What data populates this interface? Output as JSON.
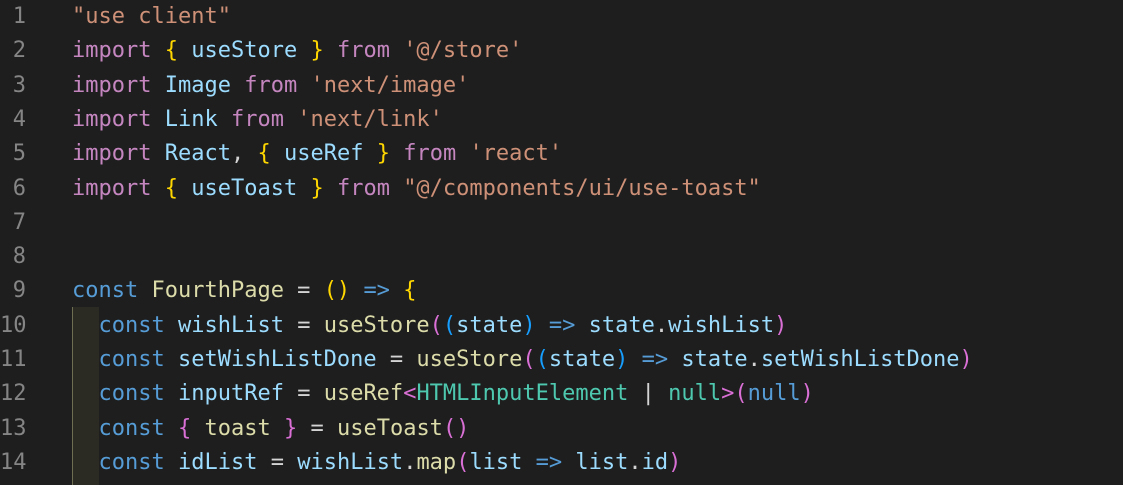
{
  "editor": {
    "lines": [
      {
        "n": "1",
        "tokens": [
          {
            "t": "\"use client\"",
            "c": "str"
          }
        ]
      },
      {
        "n": "2",
        "tokens": [
          {
            "t": "import",
            "c": "kw"
          },
          {
            "t": " ",
            "c": "plain"
          },
          {
            "t": "{",
            "c": "b1"
          },
          {
            "t": " ",
            "c": "plain"
          },
          {
            "t": "useStore",
            "c": "var"
          },
          {
            "t": " ",
            "c": "plain"
          },
          {
            "t": "}",
            "c": "b1"
          },
          {
            "t": " ",
            "c": "plain"
          },
          {
            "t": "from",
            "c": "kw"
          },
          {
            "t": " ",
            "c": "plain"
          },
          {
            "t": "'@/store'",
            "c": "str"
          }
        ]
      },
      {
        "n": "3",
        "tokens": [
          {
            "t": "import",
            "c": "kw"
          },
          {
            "t": " ",
            "c": "plain"
          },
          {
            "t": "Image",
            "c": "var"
          },
          {
            "t": " ",
            "c": "plain"
          },
          {
            "t": "from",
            "c": "kw"
          },
          {
            "t": " ",
            "c": "plain"
          },
          {
            "t": "'next/image'",
            "c": "str"
          }
        ]
      },
      {
        "n": "4",
        "tokens": [
          {
            "t": "import",
            "c": "kw"
          },
          {
            "t": " ",
            "c": "plain"
          },
          {
            "t": "Link",
            "c": "var"
          },
          {
            "t": " ",
            "c": "plain"
          },
          {
            "t": "from",
            "c": "kw"
          },
          {
            "t": " ",
            "c": "plain"
          },
          {
            "t": "'next/link'",
            "c": "str"
          }
        ]
      },
      {
        "n": "5",
        "tokens": [
          {
            "t": "import",
            "c": "kw"
          },
          {
            "t": " ",
            "c": "plain"
          },
          {
            "t": "React",
            "c": "var"
          },
          {
            "t": ", ",
            "c": "plain"
          },
          {
            "t": "{",
            "c": "b1"
          },
          {
            "t": " ",
            "c": "plain"
          },
          {
            "t": "useRef",
            "c": "var"
          },
          {
            "t": " ",
            "c": "plain"
          },
          {
            "t": "}",
            "c": "b1"
          },
          {
            "t": " ",
            "c": "plain"
          },
          {
            "t": "from",
            "c": "kw"
          },
          {
            "t": " ",
            "c": "plain"
          },
          {
            "t": "'react'",
            "c": "str"
          }
        ]
      },
      {
        "n": "6",
        "tokens": [
          {
            "t": "import",
            "c": "kw"
          },
          {
            "t": " ",
            "c": "plain"
          },
          {
            "t": "{",
            "c": "b1"
          },
          {
            "t": " ",
            "c": "plain"
          },
          {
            "t": "useToast",
            "c": "var"
          },
          {
            "t": " ",
            "c": "plain"
          },
          {
            "t": "}",
            "c": "b1"
          },
          {
            "t": " ",
            "c": "plain"
          },
          {
            "t": "from",
            "c": "kw"
          },
          {
            "t": " ",
            "c": "plain"
          },
          {
            "t": "\"@/components/ui/use-toast\"",
            "c": "str"
          }
        ]
      },
      {
        "n": "7",
        "tokens": []
      },
      {
        "n": "8",
        "tokens": []
      },
      {
        "n": "9",
        "tokens": [
          {
            "t": "const",
            "c": "kwb"
          },
          {
            "t": " ",
            "c": "plain"
          },
          {
            "t": "FourthPage",
            "c": "fn"
          },
          {
            "t": " = ",
            "c": "plain"
          },
          {
            "t": "()",
            "c": "b1"
          },
          {
            "t": " ",
            "c": "plain"
          },
          {
            "t": "=>",
            "c": "kwb"
          },
          {
            "t": " ",
            "c": "plain"
          },
          {
            "t": "{",
            "c": "b1"
          }
        ]
      },
      {
        "n": "10",
        "tokens": [
          {
            "t": "  ",
            "c": "plain"
          },
          {
            "t": "const",
            "c": "kwb"
          },
          {
            "t": " ",
            "c": "plain"
          },
          {
            "t": "wishList",
            "c": "var"
          },
          {
            "t": " = ",
            "c": "plain"
          },
          {
            "t": "useStore",
            "c": "fn"
          },
          {
            "t": "(",
            "c": "b2"
          },
          {
            "t": "(",
            "c": "b3"
          },
          {
            "t": "state",
            "c": "var"
          },
          {
            "t": ")",
            "c": "b3"
          },
          {
            "t": " ",
            "c": "plain"
          },
          {
            "t": "=>",
            "c": "kwb"
          },
          {
            "t": " ",
            "c": "plain"
          },
          {
            "t": "state",
            "c": "var"
          },
          {
            "t": ".",
            "c": "plain"
          },
          {
            "t": "wishList",
            "c": "var"
          },
          {
            "t": ")",
            "c": "b2"
          }
        ]
      },
      {
        "n": "11",
        "tokens": [
          {
            "t": "  ",
            "c": "plain"
          },
          {
            "t": "const",
            "c": "kwb"
          },
          {
            "t": " ",
            "c": "plain"
          },
          {
            "t": "setWishListDone",
            "c": "var"
          },
          {
            "t": " = ",
            "c": "plain"
          },
          {
            "t": "useStore",
            "c": "fn"
          },
          {
            "t": "(",
            "c": "b2"
          },
          {
            "t": "(",
            "c": "b3"
          },
          {
            "t": "state",
            "c": "var"
          },
          {
            "t": ")",
            "c": "b3"
          },
          {
            "t": " ",
            "c": "plain"
          },
          {
            "t": "=>",
            "c": "kwb"
          },
          {
            "t": " ",
            "c": "plain"
          },
          {
            "t": "state",
            "c": "var"
          },
          {
            "t": ".",
            "c": "plain"
          },
          {
            "t": "setWishListDone",
            "c": "var"
          },
          {
            "t": ")",
            "c": "b2"
          }
        ]
      },
      {
        "n": "12",
        "tokens": [
          {
            "t": "  ",
            "c": "plain"
          },
          {
            "t": "const",
            "c": "kwb"
          },
          {
            "t": " ",
            "c": "plain"
          },
          {
            "t": "inputRef",
            "c": "var"
          },
          {
            "t": " = ",
            "c": "plain"
          },
          {
            "t": "useRef",
            "c": "fn"
          },
          {
            "t": "<",
            "c": "b2"
          },
          {
            "t": "HTMLInputElement",
            "c": "ty"
          },
          {
            "t": " | ",
            "c": "plain"
          },
          {
            "t": "null",
            "c": "ty"
          },
          {
            "t": ">",
            "c": "b2"
          },
          {
            "t": "(",
            "c": "b2"
          },
          {
            "t": "null",
            "c": "kwb"
          },
          {
            "t": ")",
            "c": "b2"
          }
        ]
      },
      {
        "n": "13",
        "tokens": [
          {
            "t": "  ",
            "c": "plain"
          },
          {
            "t": "const",
            "c": "kwb"
          },
          {
            "t": " ",
            "c": "plain"
          },
          {
            "t": "{",
            "c": "b2"
          },
          {
            "t": " ",
            "c": "plain"
          },
          {
            "t": "toast",
            "c": "fn"
          },
          {
            "t": " ",
            "c": "plain"
          },
          {
            "t": "}",
            "c": "b2"
          },
          {
            "t": " = ",
            "c": "plain"
          },
          {
            "t": "useToast",
            "c": "fn"
          },
          {
            "t": "()",
            "c": "b2"
          }
        ]
      },
      {
        "n": "14",
        "tokens": [
          {
            "t": "  ",
            "c": "plain"
          },
          {
            "t": "const",
            "c": "kwb"
          },
          {
            "t": " ",
            "c": "plain"
          },
          {
            "t": "idList",
            "c": "var"
          },
          {
            "t": " = ",
            "c": "plain"
          },
          {
            "t": "wishList",
            "c": "var"
          },
          {
            "t": ".",
            "c": "plain"
          },
          {
            "t": "map",
            "c": "fn"
          },
          {
            "t": "(",
            "c": "b2"
          },
          {
            "t": "list",
            "c": "var"
          },
          {
            "t": " ",
            "c": "plain"
          },
          {
            "t": "=>",
            "c": "kwb"
          },
          {
            "t": " ",
            "c": "plain"
          },
          {
            "t": "list",
            "c": "var"
          },
          {
            "t": ".",
            "c": "plain"
          },
          {
            "t": "id",
            "c": "var"
          },
          {
            "t": ")",
            "c": "b2"
          }
        ]
      }
    ]
  }
}
